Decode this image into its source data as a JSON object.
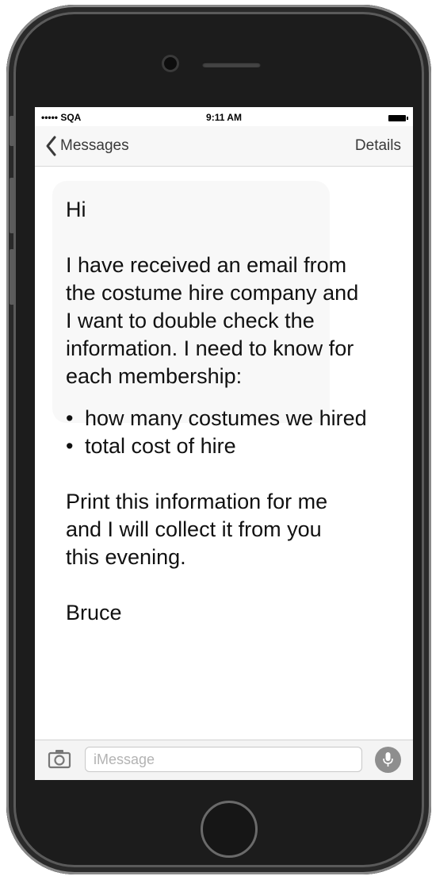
{
  "status_bar": {
    "carrier": "••••• SQA",
    "time": "9:11 AM"
  },
  "nav": {
    "back_label": "Messages",
    "details_label": "Details"
  },
  "message": {
    "greeting": "Hi",
    "body_lines": [
      "I have received an email from",
      "the costume hire company and",
      "I want to double check the",
      "information. I need to know for",
      "each membership:"
    ],
    "bullets": [
      "how many costumes we hired",
      "total cost of hire"
    ],
    "closing_lines": [
      "Print this information for me",
      "and I will collect it from you",
      "this evening."
    ],
    "signature": "Bruce"
  },
  "input": {
    "placeholder": "iMessage",
    "value": ""
  },
  "icons": {
    "back": "chevron-left-icon",
    "camera": "camera-icon",
    "mic": "microphone-icon",
    "battery": "battery-icon"
  },
  "colors": {
    "phone_body": "#1c1c1c",
    "nav_text": "#3a3a3a",
    "mic_button": "#8e8e8e"
  }
}
